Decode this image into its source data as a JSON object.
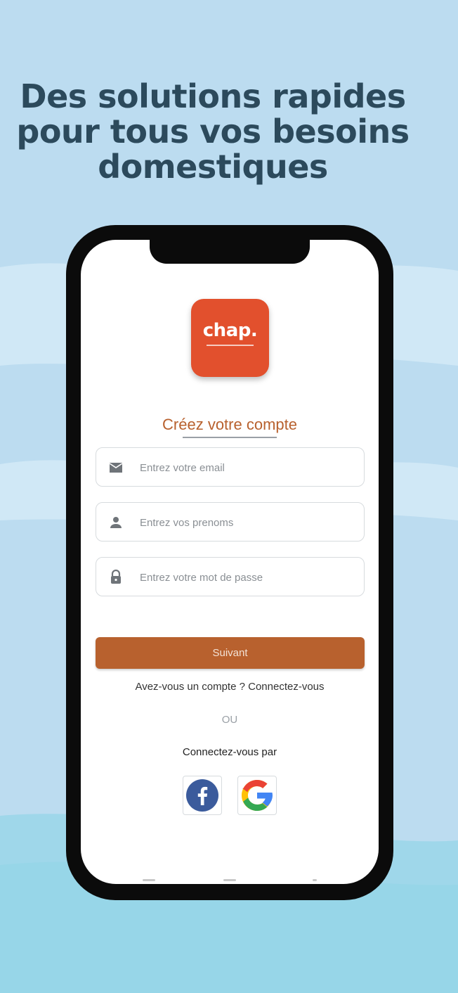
{
  "page": {
    "headline": "Des solutions rapides pour tous vos besoins domestiques",
    "background_color": "#bcdcf0",
    "accent_color": "#b8612e"
  },
  "app": {
    "logo_text": "chap.",
    "logo_color": "#e2502d",
    "title": "Créez votre compte"
  },
  "form": {
    "email": {
      "placeholder": "Entrez votre email",
      "value": "",
      "icon": "mail-icon"
    },
    "firstname": {
      "placeholder": "Entrez vos prenoms",
      "value": "",
      "icon": "person-icon"
    },
    "password": {
      "placeholder": "Entrez votre mot de passe",
      "value": "",
      "icon": "lock-icon"
    },
    "submit_label": "Suivant"
  },
  "footer": {
    "signin_prompt": "Avez-vous un compte ? Connectez-vous",
    "or_label": "OU",
    "connect_with_label": "Connectez-vous par",
    "social": [
      {
        "icon": "facebook-icon"
      },
      {
        "icon": "google-icon"
      }
    ]
  }
}
